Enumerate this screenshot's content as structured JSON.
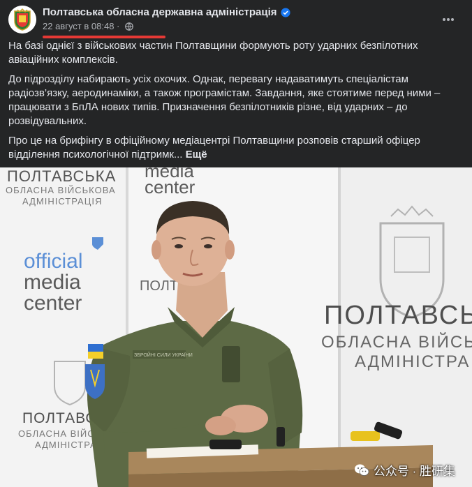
{
  "post": {
    "page_name": "Полтавська обласна державна адміністрація",
    "timestamp": "22 август в 08:48",
    "separator": " · ",
    "privacy_icon": "globe-icon",
    "more_icon": "more-horizontal-icon",
    "paragraphs": [
      "На базі однієї з військових частин Полтавщини формують роту ударних  безпілотних авіаційних комплексів.",
      "До підрозділу набирають усіх охочих. Однак, перевагу надаватимуть спеціалістам радіозв’язку, аеродинаміки, а також програмістам. Завдання, яке стоятиме перед ними – працювати з БпЛА нових типів. Призначення безпілотників різне, від ударних – до розвідувальних.",
      "Про це на брифінгу в офіційному медіацентрі Полтавщини розповів старший офіцер відділення психологічної підтримк..."
    ],
    "see_more": "Ещё"
  },
  "photo": {
    "backdrop": {
      "top_left": [
        "ПОЛТАВСЬКА",
        "ОБЛАСНА ВІЙСЬКОВА",
        "АДМІНІСТРАЦІЯ"
      ],
      "media_center_top": "media",
      "media_center_top2": "center",
      "media_left": [
        "official",
        "media",
        "center"
      ],
      "right_big": [
        "ПОЛТАВСЬ",
        "ОБЛАСНА ВІЙСЬ",
        "АДМІНІСТРА"
      ],
      "bottom_left": [
        "ПОЛТАВСЬКА",
        "ОБЛАСНА ВІЙСЬКОВА",
        "АДМІНІСТРАЦІЯ"
      ],
      "center_small": "ПОЛТА"
    },
    "name_tape": "ЗБРОЙНІ СИЛИ УКРАЇНИ"
  },
  "watermark": {
    "text": "公众号 · 胜研集"
  },
  "colors": {
    "background": "#242526",
    "text": "#e4e6eb",
    "secondary": "#b0b3b8",
    "verified": "#1877f2",
    "annotation": "#e53935",
    "uniform": "#5d6a45"
  }
}
